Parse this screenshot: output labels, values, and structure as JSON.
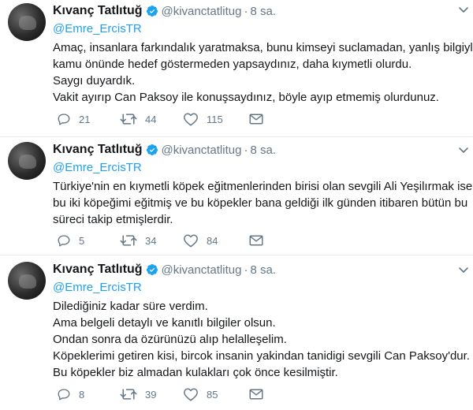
{
  "tweets": [
    {
      "author_name": "Kıvanç Tatlıtuğ",
      "author_handle": "@kivanctatlitug",
      "separator": "·",
      "time": "8 sa.",
      "reply_to": "@Emre_ErcisTR",
      "lines": [
        "Amaç, insanlara farkındalık yaratmaksa, bunu kimseyi suclamadan, yanlış bilgiyle",
        "kamu önünde hedef göstermeden yapsaydınız, daha kıymetli olurdu.",
        "Saygı duyardık.",
        "Vakit ayırıp Can Paksoy ile konuşsaydınız, böyle ayıp etmemiş olurdunuz."
      ],
      "replies": "21",
      "retweets": "44",
      "likes": "115"
    },
    {
      "author_name": "Kıvanç Tatlıtuğ",
      "author_handle": "@kivanctatlitug",
      "separator": "·",
      "time": "8 sa.",
      "reply_to": "@Emre_ErcisTR",
      "lines": [
        "Türkiye'nin en kıymetli köpek eğitmenlerinden birisi olan sevgili Ali Yeşilırmak ise",
        "bu iki köpeğimi eğitmiş ve bu köpekler bana geldiği ilk günden itibaren bütün bu",
        "süreci takip etmişlerdir."
      ],
      "replies": "5",
      "retweets": "34",
      "likes": "84"
    },
    {
      "author_name": "Kıvanç Tatlıtuğ",
      "author_handle": "@kivanctatlitug",
      "separator": "·",
      "time": "8 sa.",
      "reply_to": "@Emre_ErcisTR",
      "lines": [
        "Dilediğiniz kadar süre verdim.",
        "Ama belgeli detaylı ve kanıtlı bilgiler olsun.",
        "Ondan sonra da özürünüzü alıp helalleşelim.",
        "Köpeklerimi getiren kisi, bircok insanin yakindan tanidigi  sevgili Can Paksoy'dur.",
        "Bu köpekler biz almadan kulakları çok önce kesilmiştir."
      ],
      "replies": "8",
      "retweets": "39",
      "likes": "85"
    }
  ],
  "colors": {
    "verified": "#1da1f2",
    "link": "#1da1f2",
    "muted": "#657786",
    "divider": "#e6ecf0"
  },
  "icons": [
    "verified-badge-icon",
    "chevron-down-icon",
    "reply-icon",
    "retweet-icon",
    "like-icon",
    "direct-message-icon"
  ]
}
